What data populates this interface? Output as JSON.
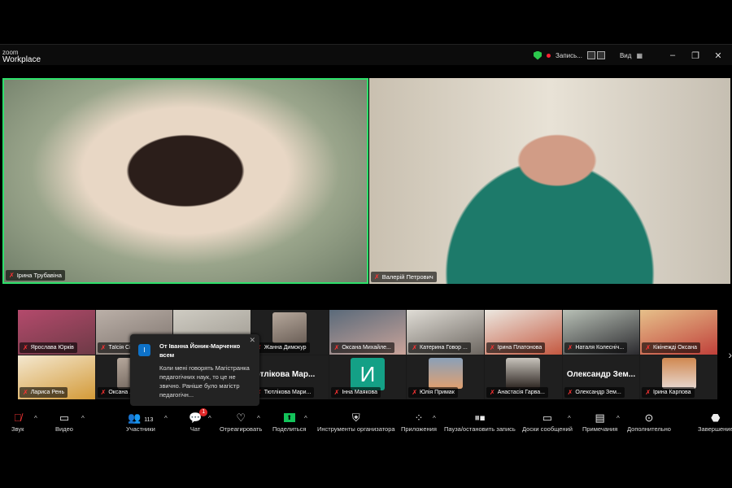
{
  "app": {
    "logo_small": "zoom",
    "logo_big": "Workplace",
    "recording_label": "Запись...",
    "view_label": "Вид"
  },
  "main": {
    "speaker1": "Ірина  Трубавіна",
    "speaker2": "Валерій Петрович",
    "active_border_color": "#2ee06b"
  },
  "gallery": {
    "row1": [
      "Ярослава Юрків",
      "Таїсія Сі...",
      "",
      "Жанна Димокур",
      "Оксана Михайле...",
      "Катерина Говор ...",
      "Ірина Платонова",
      "Наталя Колеснiч...",
      "Кікінежді Оксана"
    ],
    "row2": [
      "Лариса Рень",
      "Оксана ...",
      "",
      "Тютлікова Мари...",
      "Інна Маякова",
      "Юлія Примак",
      "Анастасія Гарва...",
      "Олександр Зем...",
      "Ірина Карпова"
    ],
    "big_names": {
      "tiutlikova": "Тютлікова  Мар...",
      "oleksandr": "Олександр  Зем..."
    },
    "initial": "И"
  },
  "chat_popup": {
    "avatar": "І",
    "from": "От Іванна Йоник-Марченко",
    "to": "всем",
    "message": "Коли мені говорять Магістранка педагогічних наук, то це не звично. Раніше було магістр педагогічн..."
  },
  "toolbar": {
    "audio": "Звук",
    "video": "Видео",
    "participants": "Участники",
    "participants_count": "113",
    "chat": "Чат",
    "chat_badge": "1",
    "react": "Отреагировать",
    "share": "Поделиться",
    "host_tools": "Инструменты организатора",
    "apps": "Приложения",
    "record": "Пауза/остановить запись",
    "whiteboards": "Доски сообщений",
    "notes": "Примечания",
    "more": "Дополнительно",
    "end": "Завершение"
  }
}
